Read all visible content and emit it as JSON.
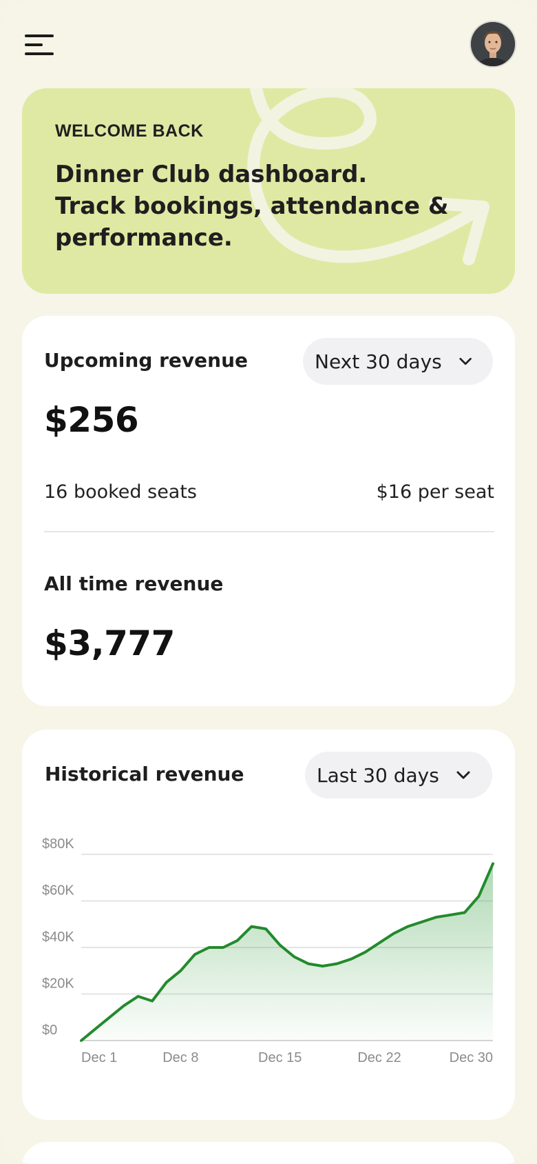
{
  "header": {
    "menu_icon": "hamburger-menu-icon",
    "avatar_icon": "user-avatar"
  },
  "hero": {
    "eyebrow": "WELCOME BACK",
    "headline_lines": [
      "Dinner Club dashboard.",
      "Track bookings, attendance &",
      "performance."
    ],
    "background_color": "#dfe9a3"
  },
  "upcoming": {
    "label": "Upcoming revenue",
    "range_selected": "Next 30 days",
    "value": "$256",
    "booked_seats": "16 booked seats",
    "per_seat": "$16 per seat"
  },
  "all_time": {
    "label": "All time revenue",
    "value": "$3,777"
  },
  "historical": {
    "label": "Historical revenue",
    "range_selected": "Last 30 days"
  },
  "chart_data": {
    "type": "area",
    "title": "",
    "xlabel": "",
    "ylabel": "",
    "x_tick_labels": [
      "Dec 1",
      "Dec 8",
      "Dec 15",
      "Dec 22",
      "Dec 30"
    ],
    "y_tick_labels": [
      "$80K",
      "$60K",
      "$40K",
      "$20K",
      "$0"
    ],
    "ylim": [
      0,
      80000
    ],
    "xlim": [
      1,
      30
    ],
    "grid": true,
    "legend": "none",
    "line_color": "#238a2c",
    "series": [
      {
        "x": [
          1,
          2,
          3,
          4,
          5,
          6,
          7,
          8,
          9,
          10,
          11,
          12,
          13,
          14,
          15,
          16,
          17,
          18,
          19,
          20,
          21,
          22,
          23,
          24,
          25,
          26,
          27,
          28,
          29,
          30
        ],
        "values": [
          0,
          5000,
          10000,
          15000,
          19000,
          17000,
          25000,
          30000,
          37000,
          40000,
          40000,
          43000,
          49000,
          48000,
          41000,
          36000,
          33000,
          32000,
          33000,
          35000,
          38000,
          42000,
          46000,
          49000,
          51000,
          53000,
          54000,
          55000,
          62000,
          76000
        ]
      }
    ]
  }
}
